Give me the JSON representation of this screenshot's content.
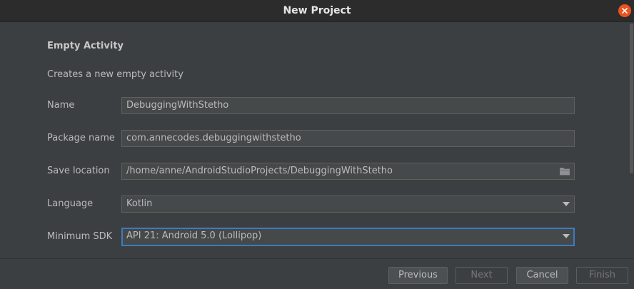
{
  "window": {
    "title": "New Project",
    "close_icon": "close-icon"
  },
  "activity": {
    "heading": "Empty Activity",
    "description": "Creates a new empty activity"
  },
  "form": {
    "name": {
      "label": "Name",
      "value": "DebuggingWithStetho"
    },
    "package_name": {
      "label": "Package name",
      "value": "com.annecodes.debuggingwithstetho"
    },
    "save_location": {
      "label": "Save location",
      "value": "/home/anne/AndroidStudioProjects/DebuggingWithStetho",
      "icon": "folder-icon"
    },
    "language": {
      "label": "Language",
      "value": "Kotlin",
      "icon": "chevron-down-icon"
    },
    "minimum_sdk": {
      "label": "Minimum SDK",
      "value": "API 21: Android 5.0 (Lollipop)",
      "icon": "chevron-down-icon"
    }
  },
  "buttons": {
    "previous": "Previous",
    "next": "Next",
    "cancel": "Cancel",
    "finish": "Finish"
  },
  "colors": {
    "accent_focus": "#3d7abf",
    "close_button": "#e95420",
    "background": "#3c3f41"
  }
}
